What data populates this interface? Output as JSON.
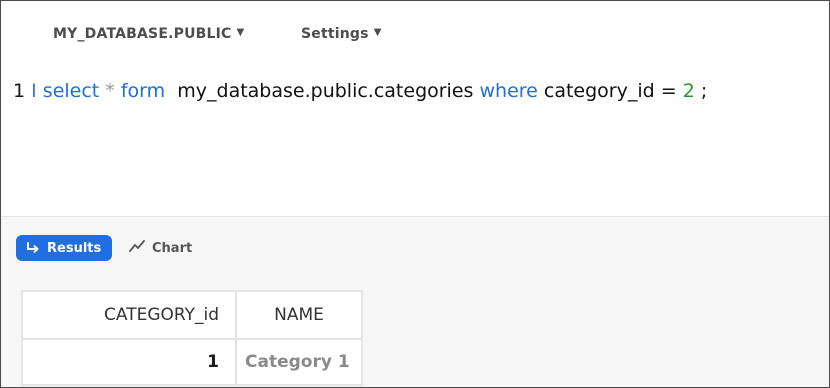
{
  "toolbar": {
    "database_selector": "MY_DATABASE.PUBLIC",
    "settings_menu": "Settings",
    "dropdown_glyph": "▼"
  },
  "editor": {
    "line_number": "1",
    "cursor_glyph": "I",
    "tokens": {
      "select": "select",
      "star": "*",
      "form": "form",
      "table": "my_database.public.categories",
      "where": "where",
      "column": "category_id",
      "op": "=",
      "value": "2",
      "semicolon": ";"
    }
  },
  "results": {
    "results_tab": "Results",
    "chart_tab": "Chart",
    "results_icon": "return-arrow-icon",
    "chart_icon": "line-chart-icon",
    "accent_color": "#1f6fe0"
  },
  "table": {
    "headers": [
      "CATEGORY_id",
      "NAME"
    ],
    "rows": [
      [
        "1",
        "Category 1"
      ]
    ]
  }
}
